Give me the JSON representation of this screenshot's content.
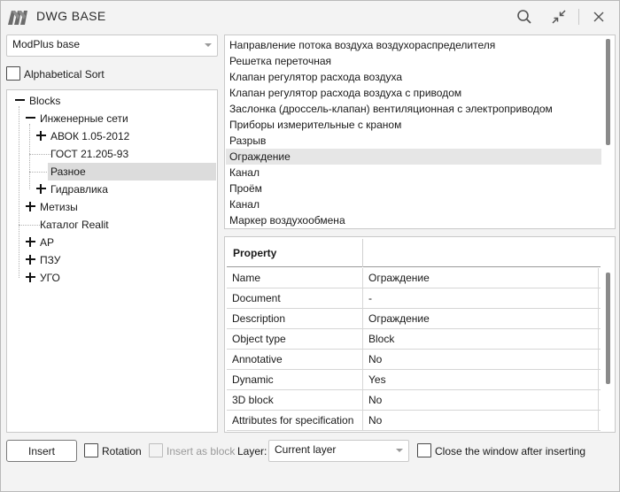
{
  "window": {
    "title": "DWG BASE"
  },
  "source_select": {
    "value": "ModPlus base"
  },
  "alpha_sort": {
    "label": "Alphabetical Sort",
    "checked": false
  },
  "tree": {
    "root": "Blocks",
    "engineering": "Инженерные сети",
    "avok": "АВОК 1.05-2012",
    "gost": "ГОСТ 21.205-93",
    "misc": "Разное",
    "hydraulics": "Гидравлика",
    "metizy": "Метизы",
    "catalog": "Каталог Realit",
    "ar": "АР",
    "pzu": "ПЗУ",
    "ugo": "УГО"
  },
  "blocks": [
    "Направление потока воздуха воздухораспределителя",
    "Решетка переточная",
    "Клапан регулятор расхода воздуха",
    "Клапан регулятор расхода воздуха с приводом",
    "Заслонка (дроссель-клапан) вентиляционная с электроприводом",
    "Приборы измерительные с краном",
    "Разрыв",
    "Ограждение",
    "Канал",
    "Проём",
    "Канал",
    "Маркер воздухообмена"
  ],
  "selected_block_index": 7,
  "properties": {
    "header": "Property",
    "rows": [
      {
        "key": "Name",
        "value": "Ограждение"
      },
      {
        "key": "Document",
        "value": "-"
      },
      {
        "key": "Description",
        "value": "Ограждение"
      },
      {
        "key": "Object type",
        "value": "Block"
      },
      {
        "key": "Annotative",
        "value": "No"
      },
      {
        "key": "Dynamic",
        "value": "Yes"
      },
      {
        "key": "3D block",
        "value": "No"
      },
      {
        "key": "Attributes for specification",
        "value": "No"
      }
    ]
  },
  "footer": {
    "insert": "Insert",
    "rotation": "Rotation",
    "insert_as_block": "Insert as block",
    "layer_label": "Layer:",
    "layer_value": "Current layer",
    "close_after": "Close the window after inserting"
  },
  "icons": [
    "app-logo-icon",
    "search-icon",
    "collapse-arrows-icon",
    "close-icon",
    "chevron-down-icon",
    "expand-icon",
    "collapse-icon"
  ]
}
